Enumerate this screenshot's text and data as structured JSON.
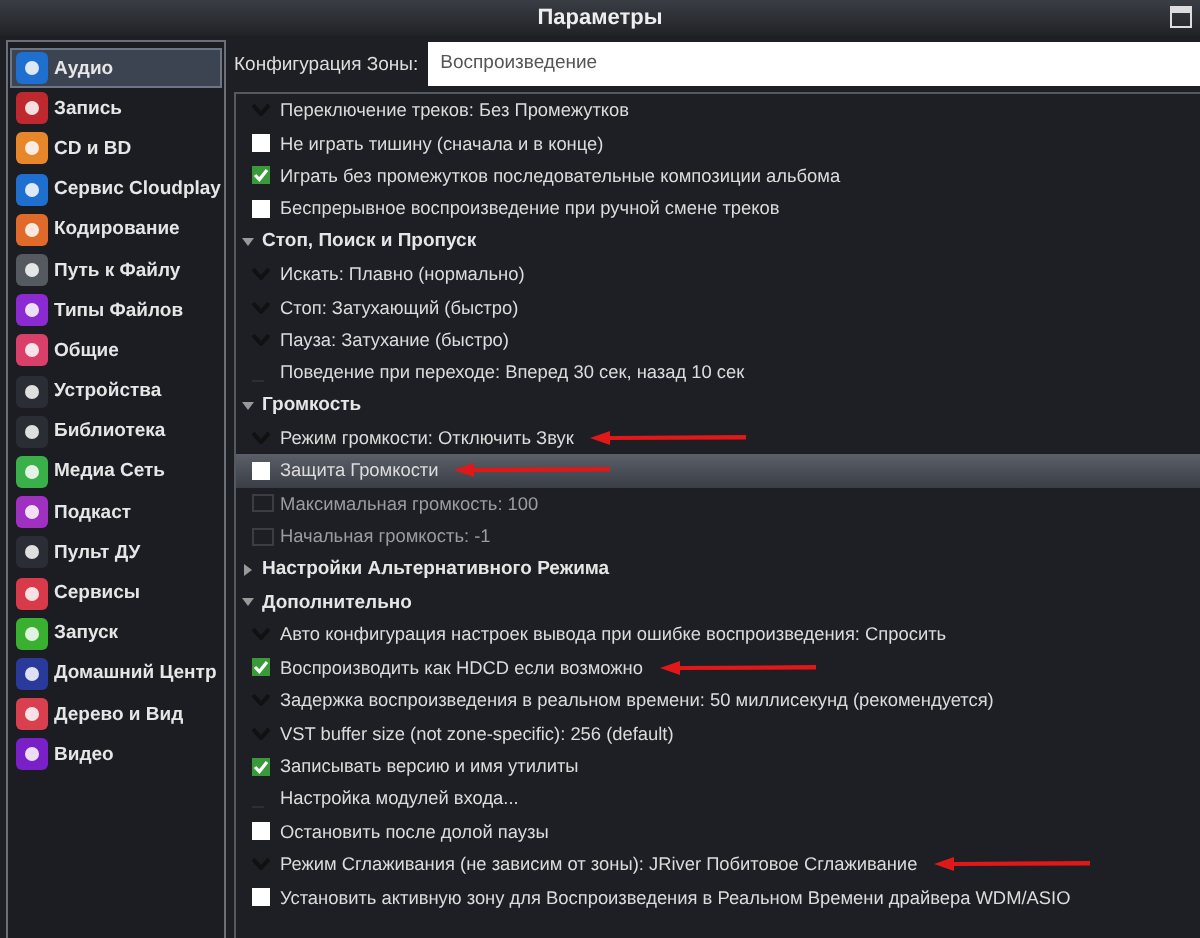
{
  "window": {
    "title": "Параметры"
  },
  "sidebar": {
    "items": [
      {
        "label": "Аудио",
        "selected": true,
        "color": "#1f6fd0"
      },
      {
        "label": "Запись",
        "selected": false,
        "color": "#c0282f"
      },
      {
        "label": "CD и BD",
        "selected": false,
        "color": "#e8862a"
      },
      {
        "label": "Сервис Cloudplay",
        "selected": false,
        "color": "#1f6fd0"
      },
      {
        "label": "Кодирование",
        "selected": false,
        "color": "#e06a2a"
      },
      {
        "label": "Путь к Файлу",
        "selected": false,
        "color": "#555a60"
      },
      {
        "label": "Типы Файлов",
        "selected": false,
        "color": "#8a2ad0"
      },
      {
        "label": "Общие",
        "selected": false,
        "color": "#d8406a"
      },
      {
        "label": "Устройства",
        "selected": false,
        "color": "#2a2d33"
      },
      {
        "label": "Библиотека",
        "selected": false,
        "color": "#2a2d33"
      },
      {
        "label": "Медиа Сеть",
        "selected": false,
        "color": "#3ab04a"
      },
      {
        "label": "Подкаст",
        "selected": false,
        "color": "#a030c0"
      },
      {
        "label": "Пульт ДУ",
        "selected": false,
        "color": "#2a2d33"
      },
      {
        "label": "Сервисы",
        "selected": false,
        "color": "#d83a4a"
      },
      {
        "label": "Запуск",
        "selected": false,
        "color": "#3ab030"
      },
      {
        "label": "Домашний Центр",
        "selected": false,
        "color": "#2a3a9a"
      },
      {
        "label": "Дерево и Вид",
        "selected": false,
        "color": "#d84050"
      },
      {
        "label": "Видео",
        "selected": false,
        "color": "#7a20c8"
      }
    ]
  },
  "zone": {
    "label": "Конфигурация Зоны:",
    "value": "Воспроизведение"
  },
  "settings": [
    {
      "kind": "dropdown",
      "label": "Переключение треков: Без Промежутков",
      "selected": false
    },
    {
      "kind": "checkbox",
      "label": "Не играть тишину (сначала и в конце)",
      "checked": false,
      "selected": false
    },
    {
      "kind": "checkbox",
      "label": "Играть без промежутков последовательные композиции альбома",
      "checked": true,
      "selected": false
    },
    {
      "kind": "checkbox",
      "label": "Беспрерывное воспроизведение при ручной смене треков",
      "checked": false,
      "selected": false
    },
    {
      "kind": "section",
      "label": "Стоп, Поиск и Пропуск",
      "expanded": true,
      "selected": false
    },
    {
      "kind": "dropdown",
      "label": "Искать: Плавно (нормально)",
      "selected": false
    },
    {
      "kind": "dropdown",
      "label": "Стоп: Затухающий (быстро)",
      "selected": false
    },
    {
      "kind": "dropdown",
      "label": "Пауза: Затухание (быстро)",
      "selected": false
    },
    {
      "kind": "action",
      "label": "Поведение при переходе: Вперед 30 сек, назад 10 сек",
      "selected": false
    },
    {
      "kind": "section",
      "label": "Громкость",
      "expanded": true,
      "selected": false
    },
    {
      "kind": "dropdown",
      "label": "Режим громкости: Отключить Звук",
      "selected": false,
      "annotated": true
    },
    {
      "kind": "checkbox",
      "label": "Защита Громкости",
      "checked": false,
      "selected": true,
      "annotated": true
    },
    {
      "kind": "disabled-field",
      "label": "Максимальная громкость: 100",
      "selected": false
    },
    {
      "kind": "disabled-field",
      "label": "Начальная громкость: -1",
      "selected": false
    },
    {
      "kind": "section",
      "label": "Настройки Альтернативного Режима",
      "expanded": false,
      "selected": false
    },
    {
      "kind": "section",
      "label": "Дополнительно",
      "expanded": true,
      "selected": false
    },
    {
      "kind": "dropdown",
      "label": "Авто конфигурация настроек вывода при ошибке воспроизведения: Спросить",
      "selected": false
    },
    {
      "kind": "checkbox",
      "label": "Воспроизводить как HDCD если возможно",
      "checked": true,
      "selected": false,
      "annotated": true
    },
    {
      "kind": "dropdown",
      "label": "Задержка воспроизведения в реальном времени: 50 миллисекунд (рекомендуется)",
      "selected": false
    },
    {
      "kind": "dropdown",
      "label": "VST buffer size (not zone-specific): 256 (default)",
      "selected": false
    },
    {
      "kind": "checkbox",
      "label": "Записывать версию и имя утилиты",
      "checked": true,
      "selected": false
    },
    {
      "kind": "action",
      "label": "Настройка модулей входа...",
      "selected": false
    },
    {
      "kind": "checkbox",
      "label": "Остановить после долой паузы",
      "checked": false,
      "selected": false
    },
    {
      "kind": "dropdown",
      "label": "Режим Сглаживания (не зависим от зоны): JRiver Побитовое Сглаживание",
      "selected": false,
      "annotated": true
    },
    {
      "kind": "checkbox",
      "label": "Установить активную зону для Воспроизведения в Реальном Времени драйвера WDM/ASIO",
      "checked": false,
      "selected": false
    }
  ]
}
